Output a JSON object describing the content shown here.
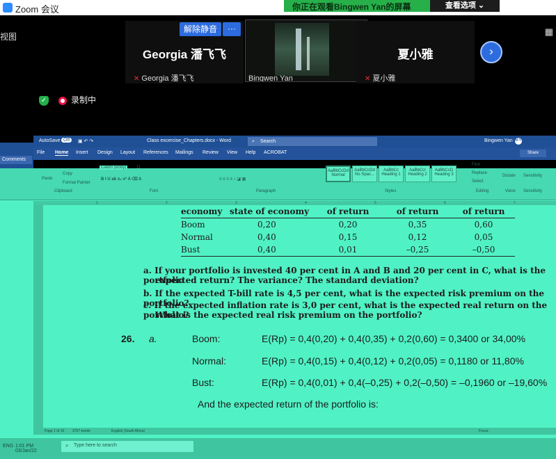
{
  "zoom": {
    "window_title": "Zoom 会议",
    "banner_text": "你正在观看Bingwen  Yan的屏幕",
    "view_options_label": "查看选项",
    "view_label": "视图",
    "mute_label": "解除静音",
    "more_label": "···",
    "participants": [
      {
        "display_name": "Georgia 潘飞飞",
        "sub_label": "Georgia 潘飞飞"
      },
      {
        "display_name": "",
        "sub_label": "Bingwen Yan"
      },
      {
        "display_name": "夏小雅",
        "sub_label": "夏小雅"
      }
    ],
    "recording_label": "录制中"
  },
  "word": {
    "autosave": "AutoSave",
    "autosave_state": "Off",
    "file_name": "Class excercise_Chapters.docx - Word",
    "search_placeholder": "Search",
    "user_name": "Bingwen Yan",
    "user_initials": "BY",
    "comments_label": "Comments",
    "share_label": "Share",
    "tabs": [
      "File",
      "Home",
      "Insert",
      "Design",
      "Layout",
      "References",
      "Mailings",
      "Review",
      "View",
      "Help",
      "ACROBAT"
    ],
    "ribbon": {
      "paste": "Paste",
      "copy": "Copy",
      "format_painter": "Format Painter",
      "clipboard": "Clipboard",
      "font_name": "Calibri (Body)",
      "font_size": "11",
      "font_group": "Font",
      "paragraph_group": "Paragraph",
      "styles_group": "Styles",
      "editing_group": "Editing",
      "voice_group": "Voice",
      "sensitivity_group": "Sensitivity",
      "find": "Find",
      "replace": "Replace",
      "select": "Select",
      "dictate": "Dictate",
      "sensitivity": "Sensitivity",
      "styles": [
        "Normal",
        "No Spac...",
        "Heading 1",
        "Heading 2",
        "Heading 3"
      ]
    },
    "status": {
      "page": "Page 1 of 16",
      "words": "3707 words",
      "language": "English (South Africa)",
      "focus": "Focus"
    }
  },
  "document": {
    "table_headers": [
      "economy",
      "state of economy",
      "of return",
      "of return",
      "of return"
    ],
    "table_rows": [
      [
        "Boom",
        "0,20",
        "0,20",
        "0,35",
        "0,60"
      ],
      [
        "Normal",
        "0,40",
        "0,15",
        "0,12",
        "0,05"
      ],
      [
        "Bust",
        "0,40",
        "0,01",
        "–0,25",
        "–0,50"
      ]
    ],
    "question_a": "a.  If your portfolio is invested 40 per cent in A and B and 20 per cent in C, what is the portfolio",
    "question_a2": "expected return? The variance? The standard deviation?",
    "question_b": "b.  If the expected T-bill rate is 4,5 per cent, what is the expected risk premium on the portfolio?",
    "question_c": "c.  If the expected inflation rate is 3,0 per cent, what is the expected real return on the portfolio?",
    "question_c2": "What is the expected real risk premium on the portfolio?",
    "answer_number": "26.",
    "answer_part": "a.",
    "boom_label": "Boom:",
    "boom_eq": "E(Rp) = 0,4(0,20) + 0,4(0,35) + 0,2(0,60) = 0,3400 or 34,00%",
    "normal_label": "Normal:",
    "normal_eq": "E(Rp) = 0,4(0,15) + 0,4(0,12) + 0,2(0,05) = 0,1180 or 11,80%",
    "bust_label": "Bust:",
    "bust_eq": "E(Rp) = 0,4(0,01) + 0,4(–0,25) + 0,2(–0,50) = –0,1960 or –19,60%",
    "expected_return_text": "And the expected return of the portfolio is:"
  },
  "taskbar": {
    "search_placeholder": "Type here to search",
    "lang": "ENG",
    "time": "1:01 PM",
    "date": "03/Jan/22"
  },
  "colors": {
    "zoom_blue": "#2d6cdf",
    "banner_green": "#27b04a",
    "word_blue": "#1f4f94",
    "teal_overlay": "#50f2c5"
  }
}
